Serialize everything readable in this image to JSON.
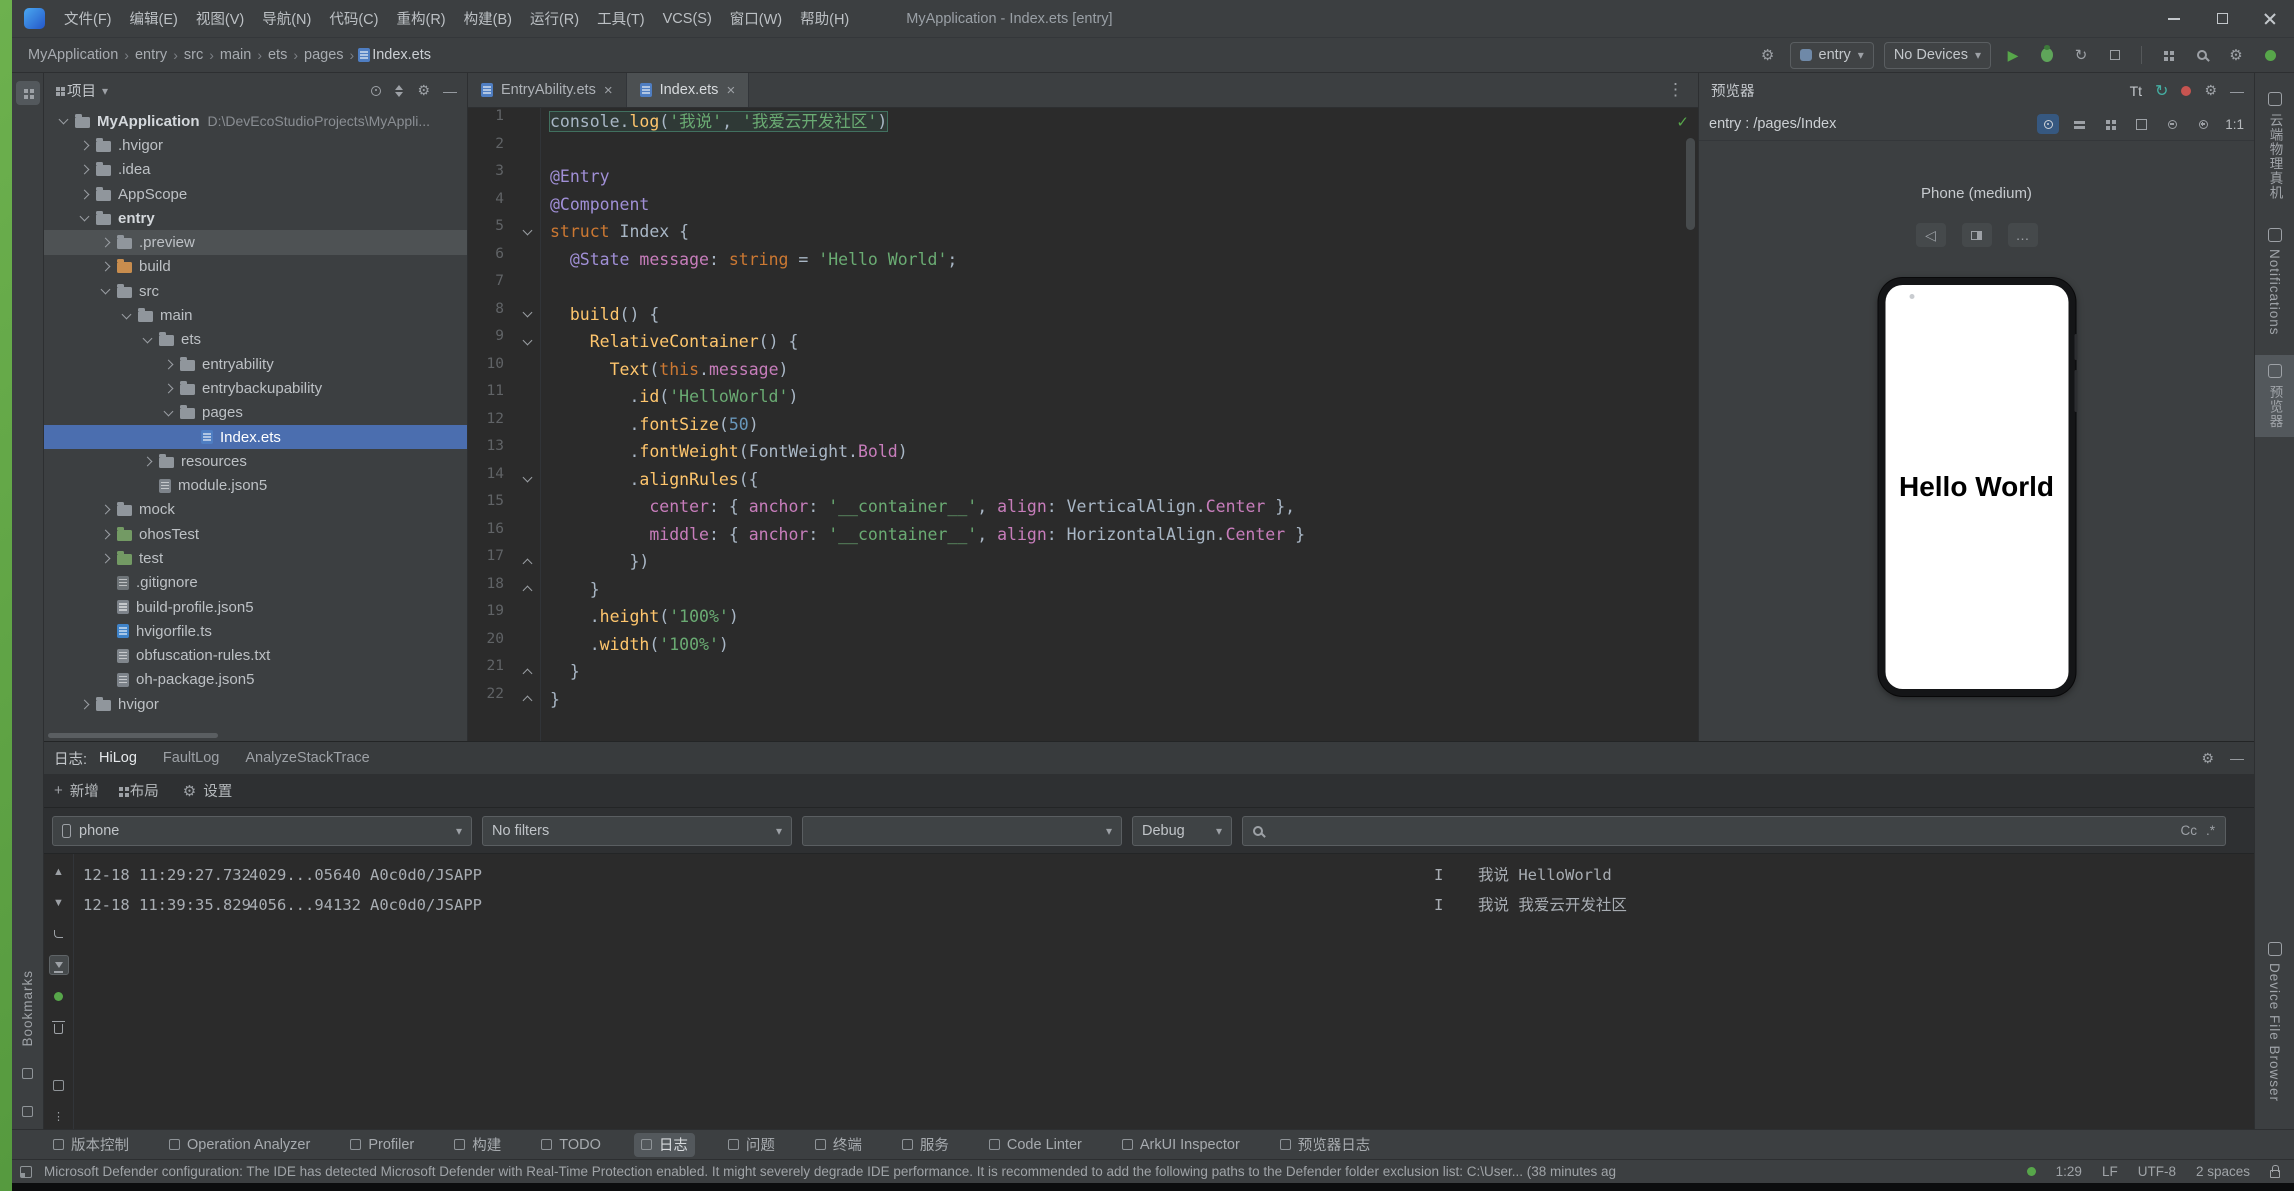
{
  "icons": {
    "close": "×",
    "dropdown": "▾",
    "more_vertical": "⋮",
    "more_horizontal": "…",
    "gear": "⚙",
    "check": "✓",
    "play": "▶",
    "minus": "—",
    "plus": "+",
    "up": "▲",
    "down": "▼",
    "rotate": "◁",
    "chevron_sep": "›",
    "refresh": "↻"
  },
  "titlebar": {
    "title": "MyApplication - Index.ets [entry]",
    "menus": [
      {
        "label": "文件(F)",
        "name": "file"
      },
      {
        "label": "编辑(E)",
        "name": "edit"
      },
      {
        "label": "视图(V)",
        "name": "view"
      },
      {
        "label": "导航(N)",
        "name": "navigate"
      },
      {
        "label": "代码(C)",
        "name": "code"
      },
      {
        "label": "重构(R)",
        "name": "refactor"
      },
      {
        "label": "构建(B)",
        "name": "build"
      },
      {
        "label": "运行(R)",
        "name": "run"
      },
      {
        "label": "工具(T)",
        "name": "tools"
      },
      {
        "label": "VCS(S)",
        "name": "vcs"
      },
      {
        "label": "窗口(W)",
        "name": "window"
      },
      {
        "label": "帮助(H)",
        "name": "help"
      }
    ]
  },
  "toolbar": {
    "breadcrumbs": [
      "MyApplication",
      "entry",
      "src",
      "main",
      "ets",
      "pages",
      "Index.ets"
    ],
    "module_selector": "entry",
    "device_selector": "No Devices"
  },
  "project": {
    "panel_title": "项目",
    "tree": [
      {
        "label": "MyApplication",
        "extra": "D:\\DevEcoStudioProjects\\MyAppli...",
        "level": 0,
        "chevron": "v",
        "icon": "folder",
        "bold": true
      },
      {
        "label": ".hvigor",
        "level": 1,
        "chevron": ">",
        "icon": "folder"
      },
      {
        "label": ".idea",
        "level": 1,
        "chevron": ">",
        "icon": "folder"
      },
      {
        "label": "AppScope",
        "level": 1,
        "chevron": ">",
        "icon": "folder"
      },
      {
        "label": "entry",
        "level": 1,
        "chevron": "v",
        "icon": "folder",
        "bold": true
      },
      {
        "label": ".preview",
        "level": 2,
        "chevron": ">",
        "icon": "folder",
        "muted": true
      },
      {
        "label": "build",
        "level": 2,
        "chevron": ">",
        "icon": "folder-orange"
      },
      {
        "label": "src",
        "level": 2,
        "chevron": "v",
        "icon": "folder"
      },
      {
        "label": "main",
        "level": 3,
        "chevron": "v",
        "icon": "folder"
      },
      {
        "label": "ets",
        "level": 4,
        "chevron": "v",
        "icon": "folder"
      },
      {
        "label": "entryability",
        "level": 5,
        "chevron": ">",
        "icon": "folder"
      },
      {
        "label": "entrybackupability",
        "level": 5,
        "chevron": ">",
        "icon": "folder"
      },
      {
        "label": "pages",
        "level": 5,
        "chevron": "v",
        "icon": "folder"
      },
      {
        "label": "Index.ets",
        "level": 6,
        "chevron": "",
        "icon": "file-ets",
        "selected": true
      },
      {
        "label": "resources",
        "level": 4,
        "chevron": ">",
        "icon": "folder"
      },
      {
        "label": "module.json5",
        "level": 4,
        "chevron": "",
        "icon": "file-json"
      },
      {
        "label": "mock",
        "level": 2,
        "chevron": ">",
        "icon": "folder"
      },
      {
        "label": "ohosTest",
        "level": 2,
        "chevron": ">",
        "icon": "folder-green"
      },
      {
        "label": "test",
        "level": 2,
        "chevron": ">",
        "icon": "folder-green"
      },
      {
        "label": ".gitignore",
        "level": 2,
        "chevron": "",
        "icon": "file-git"
      },
      {
        "label": "build-profile.json5",
        "level": 2,
        "chevron": "",
        "icon": "file-json"
      },
      {
        "label": "hvigorfile.ts",
        "level": 2,
        "chevron": "",
        "icon": "file-ts"
      },
      {
        "label": "obfuscation-rules.txt",
        "level": 2,
        "chevron": "",
        "icon": "file-txt"
      },
      {
        "label": "oh-package.json5",
        "level": 2,
        "chevron": "",
        "icon": "file-json"
      },
      {
        "label": "hvigor",
        "level": 1,
        "chevron": ">",
        "icon": "folder"
      }
    ]
  },
  "editor": {
    "tabs": [
      {
        "label": "EntryAbility.ets",
        "name": "entryability-tab",
        "active": false
      },
      {
        "label": "Index.ets",
        "name": "index-tab",
        "active": true
      }
    ],
    "code": [
      {
        "n": 1,
        "fold": "",
        "hl": true,
        "tokens": [
          [
            "pl",
            "console."
          ],
          [
            "fn",
            "log"
          ],
          [
            "pl",
            "("
          ],
          [
            "str",
            "'我说'"
          ],
          [
            "pl",
            ", "
          ],
          [
            "str",
            "'我爱云开发社区'"
          ],
          [
            "pl",
            ")"
          ]
        ]
      },
      {
        "n": 2,
        "fold": "",
        "tokens": []
      },
      {
        "n": 3,
        "fold": "",
        "tokens": [
          [
            "dec",
            "@Entry"
          ]
        ]
      },
      {
        "n": 4,
        "fold": "",
        "tokens": [
          [
            "dec",
            "@Component"
          ]
        ]
      },
      {
        "n": 5,
        "fold": "v",
        "tokens": [
          [
            "kw",
            "struct"
          ],
          [
            "pl",
            " Index {"
          ]
        ]
      },
      {
        "n": 6,
        "fold": "",
        "tokens": [
          [
            "pl",
            "  "
          ],
          [
            "dec",
            "@State"
          ],
          [
            "pl",
            " "
          ],
          [
            "prop",
            "message"
          ],
          [
            "pl",
            ": "
          ],
          [
            "kw",
            "string"
          ],
          [
            "pl",
            " = "
          ],
          [
            "str",
            "'Hello World'"
          ],
          [
            "pl",
            ";"
          ]
        ]
      },
      {
        "n": 7,
        "fold": "",
        "tokens": []
      },
      {
        "n": 8,
        "fold": "v",
        "tokens": [
          [
            "pl",
            "  "
          ],
          [
            "fn",
            "build"
          ],
          [
            "pl",
            "() {"
          ]
        ]
      },
      {
        "n": 9,
        "fold": "v",
        "tokens": [
          [
            "pl",
            "    "
          ],
          [
            "fn",
            "RelativeContainer"
          ],
          [
            "pl",
            "() {"
          ]
        ]
      },
      {
        "n": 10,
        "fold": "",
        "tokens": [
          [
            "pl",
            "      "
          ],
          [
            "fn",
            "Text"
          ],
          [
            "pl",
            "("
          ],
          [
            "kw",
            "this"
          ],
          [
            "pl",
            "."
          ],
          [
            "prop",
            "message"
          ],
          [
            "pl",
            ")"
          ]
        ]
      },
      {
        "n": 11,
        "fold": "",
        "tokens": [
          [
            "pl",
            "        ."
          ],
          [
            "fn",
            "id"
          ],
          [
            "pl",
            "("
          ],
          [
            "str",
            "'HelloWorld'"
          ],
          [
            "pl",
            ")"
          ]
        ]
      },
      {
        "n": 12,
        "fold": "",
        "tokens": [
          [
            "pl",
            "        ."
          ],
          [
            "fn",
            "fontSize"
          ],
          [
            "pl",
            "("
          ],
          [
            "num",
            "50"
          ],
          [
            "pl",
            ")"
          ]
        ]
      },
      {
        "n": 13,
        "fold": "",
        "tokens": [
          [
            "pl",
            "        ."
          ],
          [
            "fn",
            "fontWeight"
          ],
          [
            "pl",
            "("
          ],
          [
            "pl",
            "FontWeight."
          ],
          [
            "prop",
            "Bold"
          ],
          [
            "pl",
            ")"
          ]
        ]
      },
      {
        "n": 14,
        "fold": "v",
        "tokens": [
          [
            "pl",
            "        ."
          ],
          [
            "fn",
            "alignRules"
          ],
          [
            "pl",
            "({"
          ]
        ]
      },
      {
        "n": 15,
        "fold": "",
        "tokens": [
          [
            "pl",
            "          "
          ],
          [
            "prop",
            "center"
          ],
          [
            "pl",
            ": { "
          ],
          [
            "prop",
            "anchor"
          ],
          [
            "pl",
            ": "
          ],
          [
            "str",
            "'__container__'"
          ],
          [
            "pl",
            ", "
          ],
          [
            "prop",
            "align"
          ],
          [
            "pl",
            ": VerticalAlign."
          ],
          [
            "prop",
            "Center"
          ],
          [
            "pl",
            " },"
          ]
        ]
      },
      {
        "n": 16,
        "fold": "",
        "tokens": [
          [
            "pl",
            "          "
          ],
          [
            "prop",
            "middle"
          ],
          [
            "pl",
            ": { "
          ],
          [
            "prop",
            "anchor"
          ],
          [
            "pl",
            ": "
          ],
          [
            "str",
            "'__container__'"
          ],
          [
            "pl",
            ", "
          ],
          [
            "prop",
            "align"
          ],
          [
            "pl",
            ": HorizontalAlign."
          ],
          [
            "prop",
            "Center"
          ],
          [
            "pl",
            " }"
          ]
        ]
      },
      {
        "n": 17,
        "fold": "^",
        "tokens": [
          [
            "pl",
            "        })"
          ]
        ]
      },
      {
        "n": 18,
        "fold": "^",
        "tokens": [
          [
            "pl",
            "    }"
          ]
        ]
      },
      {
        "n": 19,
        "fold": "",
        "tokens": [
          [
            "pl",
            "    ."
          ],
          [
            "fn",
            "height"
          ],
          [
            "pl",
            "("
          ],
          [
            "str",
            "'100%'"
          ],
          [
            "pl",
            ")"
          ]
        ]
      },
      {
        "n": 20,
        "fold": "",
        "tokens": [
          [
            "pl",
            "    ."
          ],
          [
            "fn",
            "width"
          ],
          [
            "pl",
            "("
          ],
          [
            "str",
            "'100%'"
          ],
          [
            "pl",
            ")"
          ]
        ]
      },
      {
        "n": 21,
        "fold": "^",
        "tokens": [
          [
            "pl",
            "  }"
          ]
        ]
      },
      {
        "n": 22,
        "fold": "^",
        "tokens": [
          [
            "pl",
            "}"
          ]
        ]
      }
    ]
  },
  "preview": {
    "panel_title": "预览器",
    "font_icon": "Tt",
    "route": "entry : /pages/Index",
    "device_label": "Phone (medium)",
    "screen_text": "Hello World",
    "zoom_label": "1:1"
  },
  "left_stripe": {
    "bookmarks": "Bookmarks"
  },
  "right_stripe": {
    "top": [
      {
        "label": "云端物理真机",
        "name": "cloud-device"
      },
      {
        "label": "Notifications",
        "name": "notifications"
      },
      {
        "label": "预览器",
        "name": "previewer",
        "active": true
      }
    ],
    "bottom": [
      {
        "label": "Device File Browser",
        "name": "device-file-browser"
      }
    ]
  },
  "log": {
    "panel_label": "日志:",
    "tabs": [
      {
        "label": "HiLog",
        "name": "hilog",
        "active": true
      },
      {
        "label": "FaultLog",
        "name": "faultlog",
        "active": false
      },
      {
        "label": "AnalyzeStackTrace",
        "name": "analyzestacktrace",
        "active": false
      }
    ],
    "actions": [
      {
        "label": "新增",
        "name": "add"
      },
      {
        "label": "布局",
        "name": "layout"
      },
      {
        "label": "设置",
        "name": "settings"
      }
    ],
    "filters": {
      "device": "phone",
      "filter": "No filters",
      "custom": "",
      "level": "Debug",
      "search_value": "",
      "match_case": "Cc",
      "regex": ".*"
    },
    "entries": [
      {
        "time": "12-18 11:29:27.732",
        "pid": "4029...05640",
        "tag": "A0c0d0/JSAPP",
        "level": "I",
        "message": "我说 HelloWorld"
      },
      {
        "time": "12-18 11:39:35.829",
        "pid": "4056...94132",
        "tag": "A0c0d0/JSAPP",
        "level": "I",
        "message": "我说 我爱云开发社区"
      }
    ]
  },
  "bottom_bar": {
    "active": "日志",
    "items": [
      {
        "label": "版本控制",
        "name": "version-control"
      },
      {
        "label": "Operation Analyzer",
        "name": "operation-analyzer"
      },
      {
        "label": "Profiler",
        "name": "profiler"
      },
      {
        "label": "构建",
        "name": "build"
      },
      {
        "label": "TODO",
        "name": "todo"
      },
      {
        "label": "日志",
        "name": "log"
      },
      {
        "label": "问题",
        "name": "problems"
      },
      {
        "label": "终端",
        "name": "terminal"
      },
      {
        "label": "服务",
        "name": "services"
      },
      {
        "label": "Code Linter",
        "name": "code-linter"
      },
      {
        "label": "ArkUI Inspector",
        "name": "arkui-inspector"
      },
      {
        "label": "预览器日志",
        "name": "previewer-log"
      }
    ]
  },
  "statusbar": {
    "message": "Microsoft Defender configuration: The IDE has detected Microsoft Defender with Real-Time Protection enabled. It might severely degrade IDE performance. It is recommended to add the following paths to the Defender folder exclusion list: C:\\User... (38 minutes ag",
    "cursor": "1:29",
    "line_ending": "LF",
    "encoding": "UTF-8",
    "indent": "2 spaces"
  }
}
